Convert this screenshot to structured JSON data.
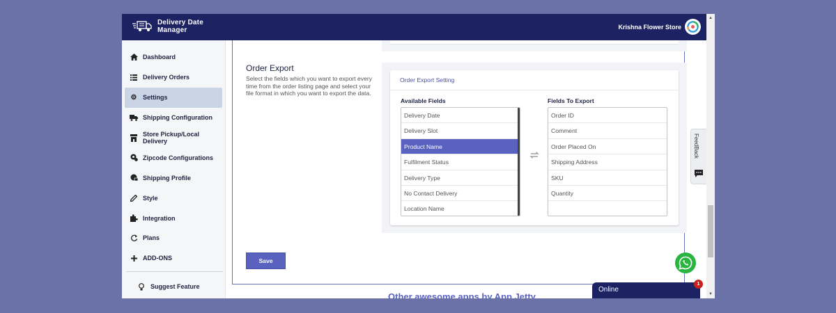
{
  "app": {
    "name_line1": "Delivery Date",
    "name_line2": "Manager",
    "store_name": "Krishna Flower Store"
  },
  "sidebar": {
    "items": [
      {
        "label": "Dashboard",
        "icon": "home-icon"
      },
      {
        "label": "Delivery Orders",
        "icon": "list-icon"
      },
      {
        "label": "Settings",
        "icon": "gear-icon",
        "active": true
      },
      {
        "label": "Shipping Configuration",
        "icon": "truck-icon"
      },
      {
        "label": "Store Pickup/Local Delivery",
        "icon": "store-icon"
      },
      {
        "label": "Zipcode Configurations",
        "icon": "location-icon"
      },
      {
        "label": "Shipping Profile",
        "icon": "shipping-profile-icon"
      },
      {
        "label": "Style",
        "icon": "pen-icon"
      },
      {
        "label": "Integration",
        "icon": "puzzle-icon"
      },
      {
        "label": "Plans",
        "icon": "refresh-icon"
      },
      {
        "label": "ADD-ONS",
        "icon": "plus-icon"
      }
    ],
    "suggest": {
      "label": "Suggest Feature",
      "icon": "lightbulb-icon"
    }
  },
  "order_export": {
    "title": "Order Export",
    "description": "Select the fields which you want to export every time from the order listing page and select your file format in which you want to export the data.",
    "card_title": "Order Export Setting",
    "available_label": "Available Fields",
    "export_label": "Fields To Export",
    "available_fields": [
      "Delivery Date",
      "Delivery Slot",
      "Product Name",
      "Fulfilment Status",
      "Delivery Type",
      "No Contact Delivery",
      "Location Name"
    ],
    "selected_available": "Product Name",
    "export_fields": [
      "Order ID",
      "Comment",
      "Order Placed On",
      "Shipping Address",
      "SKU",
      "Quantity"
    ]
  },
  "save_label": "Save",
  "other_apps": "Other awesome apps by App Jetty",
  "feedback_label": "FeedBack",
  "chat": {
    "label": "Online",
    "badge": "1"
  },
  "colors": {
    "header": "#1c2262",
    "accent": "#5963bf",
    "active_nav": "#c9d4e4",
    "whatsapp": "#2ab540"
  }
}
